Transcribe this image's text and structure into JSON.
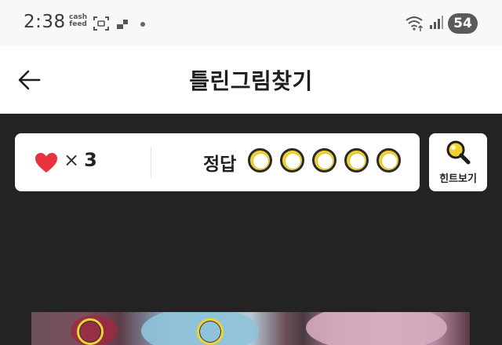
{
  "status_bar": {
    "time": "2:38",
    "cash_line1": "cash",
    "cash_line2": "feed",
    "battery": "54",
    "icons": [
      "screenshot-icon",
      "app-icon",
      "dot-icon",
      "wifi-icon",
      "signal-icon"
    ]
  },
  "header": {
    "back_icon": "arrow-left-icon",
    "title": "틀린그림찾기"
  },
  "game": {
    "lives_symbol": "×",
    "lives_count": "3",
    "answer_label": "정답",
    "answer_slots_total": 5,
    "answer_slots_found": 0,
    "hint_label": "힌트보기",
    "hint_icon": "magnifier-icon"
  },
  "colors": {
    "game_background": "#232323",
    "heart": "#e8333f",
    "slot_accent": "#f2d230"
  }
}
